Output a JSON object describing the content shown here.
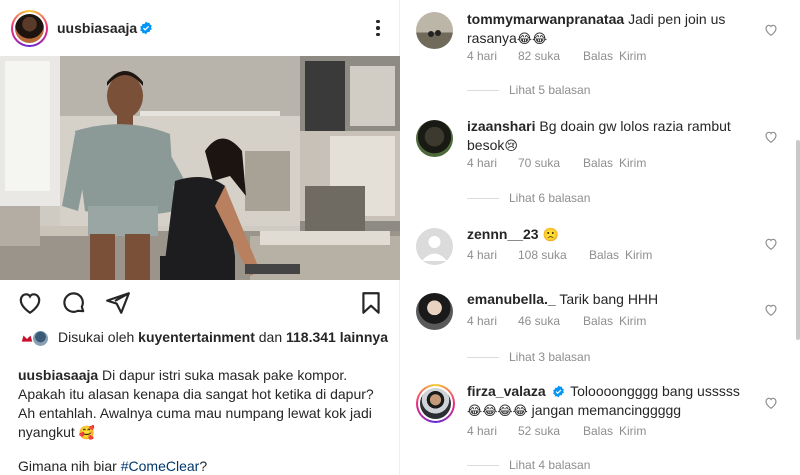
{
  "post": {
    "username": "uusbiasaaja",
    "likes_prefix": "Disukai oleh",
    "likes_user": "kuyentertainment",
    "likes_and": "dan",
    "likes_count": "118.341",
    "likes_suffix": "lainnya",
    "caption_user": "uusbiasaaja",
    "caption_text": "Di dapur istri suka masak pake kompor. Apakah itu alasan kenapa dia sangat hot ketika di dapur? Ah entahlah. Awalnya cuma mau numpang lewat kok jadi nyangkut",
    "caption_emoji": "🥰",
    "caption2_prefix": "Gimana nih biar",
    "caption2_hashtag": "#ComeClear",
    "caption2_suffix": "?",
    "icons": [
      "more-icon",
      "heart-icon",
      "comment-icon",
      "share-icon",
      "bookmark-icon",
      "verified-icon"
    ]
  },
  "comments": [
    {
      "username": "tommymarwanpranataa",
      "text_line1": "Jadi pen join us",
      "text_line2": "rasanya",
      "emoji": "😂😂",
      "time": "4 hari",
      "likes": "82 suka",
      "reply": "Balas",
      "send": "Kirim",
      "view_replies": "Lihat 5 balasan"
    },
    {
      "username": "izaanshari",
      "text_line1": "Bg doain gw lolos razia rambut",
      "text_line2": "besok",
      "emoji": "😢",
      "time": "4 hari",
      "likes": "70 suka",
      "reply": "Balas",
      "send": "Kirim",
      "view_replies": "Lihat 6 balasan"
    },
    {
      "username": "zennn__23",
      "text_line1": "",
      "emoji": "🙁",
      "time": "4 hari",
      "likes": "108 suka",
      "reply": "Balas",
      "send": "Kirim"
    },
    {
      "username": "emanubella._",
      "text_line1": "Tarik bang HHH",
      "time": "4 hari",
      "likes": "46 suka",
      "reply": "Balas",
      "send": "Kirim",
      "view_replies": "Lihat 3 balasan"
    },
    {
      "username": "firza_valaza",
      "text_line1": "Toloooongggg bang usssss",
      "emoji": "😂😂😂😂",
      "text_line2": "jangan memancinggggg",
      "time": "4 hari",
      "likes": "52 suka",
      "reply": "Balas",
      "send": "Kirim",
      "view_replies": "Lihat 4 balasan"
    }
  ],
  "colors": {
    "text": "#262626",
    "secondary": "#8e8e8e",
    "hashtag": "#00376b",
    "verified": "#0095f6"
  }
}
